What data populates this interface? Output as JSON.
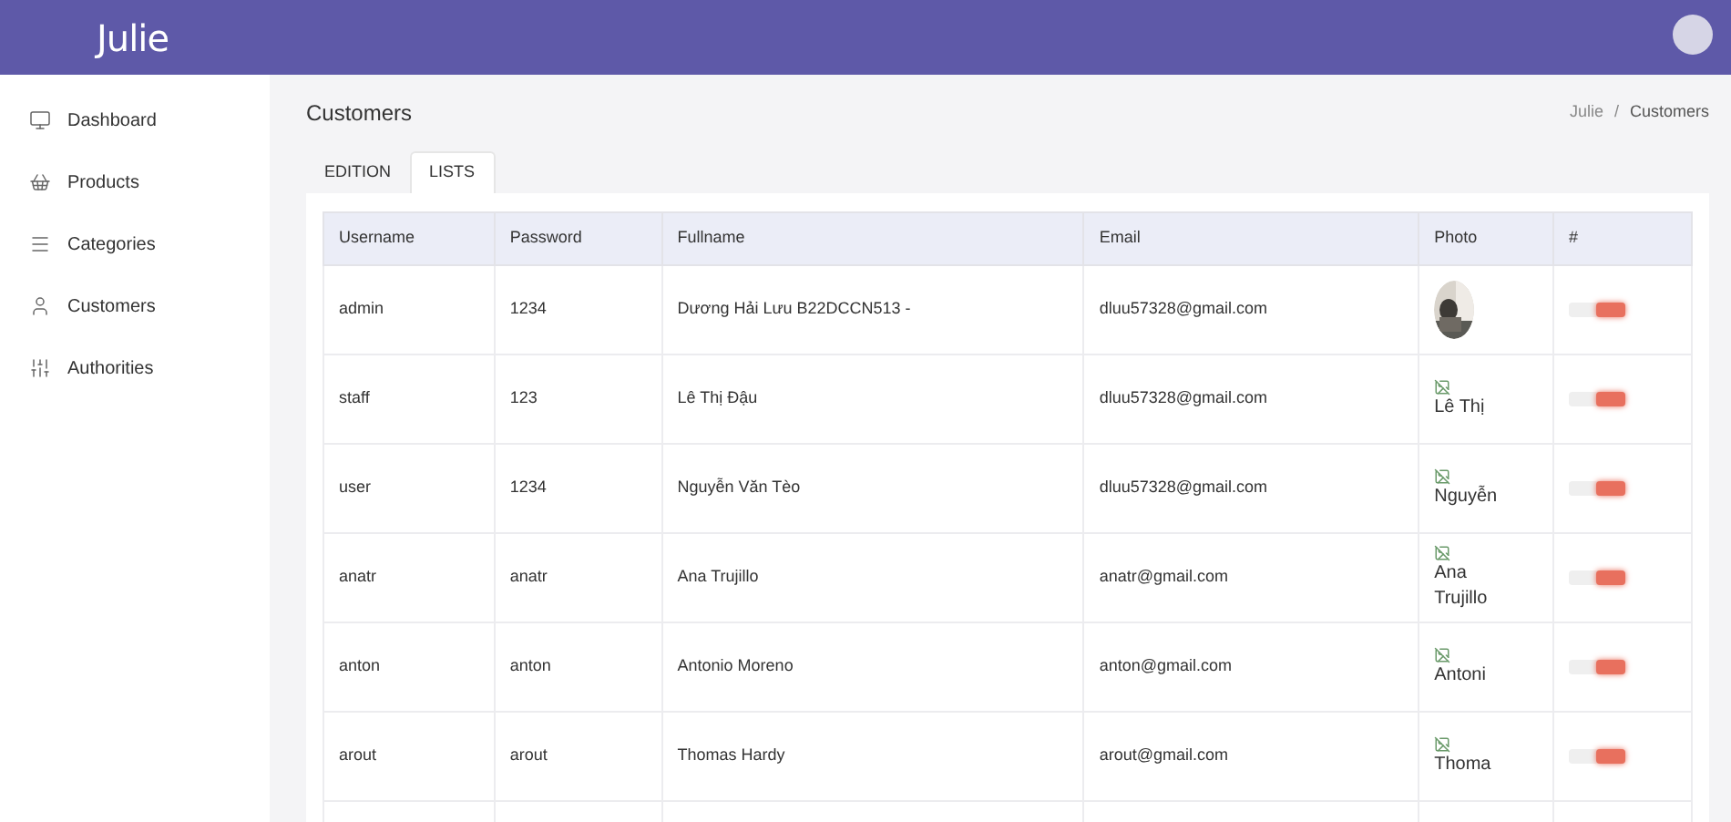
{
  "header": {
    "brand": "Julie"
  },
  "sidebar": {
    "items": [
      {
        "label": "Dashboard",
        "kind": "monitor",
        "selected": false
      },
      {
        "label": "Products",
        "kind": "basket",
        "selected": false
      },
      {
        "label": "Categories",
        "kind": "list",
        "selected": false
      },
      {
        "label": "Customers",
        "kind": "user",
        "selected": false
      },
      {
        "label": "Authorities",
        "kind": "sliders",
        "selected": false
      }
    ]
  },
  "page": {
    "title": "Customers",
    "breadcrumb": [
      "Julie",
      "Customers"
    ],
    "breadcrumb_separator": "/"
  },
  "tabs": [
    {
      "label": "EDITION",
      "selected": false
    },
    {
      "label": "LISTS",
      "selected": true
    }
  ],
  "table": {
    "columns": [
      "Username",
      "Password",
      "Fullname",
      "Email",
      "Photo",
      "#"
    ],
    "rows": [
      {
        "username": "admin",
        "password": "1234",
        "fullname": "Dương Hải Lưu B22DCCN513 -",
        "email": "dluu57328@gmail.com",
        "on": true
      },
      {
        "username": "staff",
        "password": "123",
        "fullname": "Lê Thị Đậu",
        "email": "dluu57328@gmail.com",
        "photo": {
          "kind": "broken",
          "alt": "Lê Thị"
        },
        "on": true
      },
      {
        "username": "user",
        "password": "1234",
        "fullname": "Nguyễn Văn Tèo",
        "email": "dluu57328@gmail.com",
        "photo": {
          "kind": "broken",
          "alt": "Nguyễn"
        },
        "on": true
      },
      {
        "username": "anatr",
        "password": "anatr",
        "fullname": "Ana Trujillo",
        "email": "anatr@gmail.com",
        "photo": {
          "kind": "broken",
          "alt": "Ana Trujillo"
        },
        "on": true
      },
      {
        "username": "anton",
        "password": "anton",
        "fullname": "Antonio Moreno",
        "email": "anton@gmail.com",
        "photo": {
          "kind": "broken",
          "alt": "Antoni"
        },
        "on": true
      },
      {
        "username": "arout",
        "password": "arout",
        "fullname": "Thomas Hardy",
        "email": "arout@gmail.com",
        "photo": {
          "kind": "broken",
          "alt": "Thoma"
        },
        "on": true
      }
    ]
  }
}
